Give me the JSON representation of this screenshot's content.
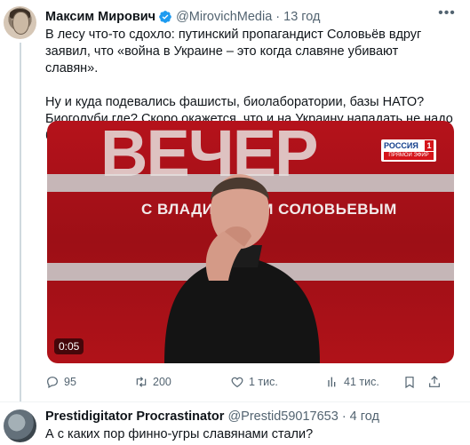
{
  "post": {
    "author_name": "Максим Мирович",
    "handle": "@MirovichMedia",
    "separator": "·",
    "time": "13 год",
    "paragraphs": [
      "В лесу что-то сдохло: путинский пропагандист Соловьёв вдруг заявил, что «война в Украине – это когда славяне убивают славян».",
      "Ну и куда подевались фашисты, биолаборатории, базы НАТО? Биоголуби где? Скоро окажется, что и на Украину нападать не надо было?"
    ],
    "video": {
      "headline": "ВЕЧЕР",
      "subtitle": "С ВЛАДИМИРОМ СОЛОВЬЕВЫМ",
      "channel_name": "РОССИЯ",
      "channel_number": "1",
      "channel_live": "ПРЯМОЙ ЭФИР",
      "duration": "0:05"
    },
    "actions": {
      "replies": "95",
      "reposts": "200",
      "likes": "1 тис.",
      "views": "41 тис."
    },
    "icons": [
      "verified-badge-icon",
      "more-icon",
      "reply-icon",
      "repost-icon",
      "like-icon",
      "views-icon",
      "bookmark-icon",
      "share-icon"
    ]
  },
  "reply": {
    "author_name": "Prestidigitator Procrastinator",
    "handle": "@Prestid59017653",
    "separator": "·",
    "time": "4 год",
    "text": "А с каких пор финно-угры славянами стали?"
  },
  "colors": {
    "text": "#0f1419",
    "secondary": "#536471",
    "verified": "#1d9bf0",
    "divider": "#eff3f4"
  }
}
